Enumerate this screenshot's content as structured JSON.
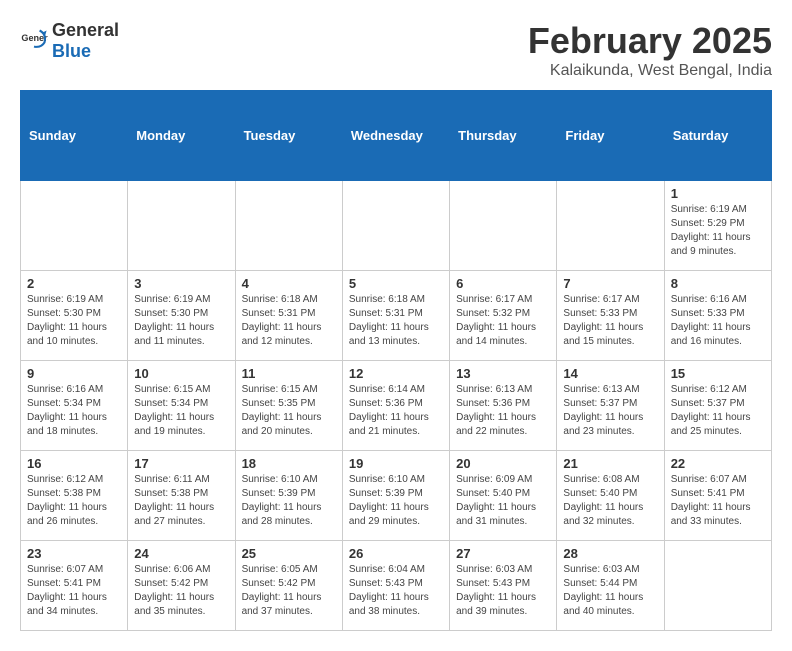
{
  "header": {
    "logo_general": "General",
    "logo_blue": "Blue",
    "title": "February 2025",
    "subtitle": "Kalaikunda, West Bengal, India"
  },
  "weekdays": [
    "Sunday",
    "Monday",
    "Tuesday",
    "Wednesday",
    "Thursday",
    "Friday",
    "Saturday"
  ],
  "weeks": [
    [
      {
        "day": "",
        "info": ""
      },
      {
        "day": "",
        "info": ""
      },
      {
        "day": "",
        "info": ""
      },
      {
        "day": "",
        "info": ""
      },
      {
        "day": "",
        "info": ""
      },
      {
        "day": "",
        "info": ""
      },
      {
        "day": "1",
        "info": "Sunrise: 6:19 AM\nSunset: 5:29 PM\nDaylight: 11 hours and 9 minutes."
      }
    ],
    [
      {
        "day": "2",
        "info": "Sunrise: 6:19 AM\nSunset: 5:30 PM\nDaylight: 11 hours and 10 minutes."
      },
      {
        "day": "3",
        "info": "Sunrise: 6:19 AM\nSunset: 5:30 PM\nDaylight: 11 hours and 11 minutes."
      },
      {
        "day": "4",
        "info": "Sunrise: 6:18 AM\nSunset: 5:31 PM\nDaylight: 11 hours and 12 minutes."
      },
      {
        "day": "5",
        "info": "Sunrise: 6:18 AM\nSunset: 5:31 PM\nDaylight: 11 hours and 13 minutes."
      },
      {
        "day": "6",
        "info": "Sunrise: 6:17 AM\nSunset: 5:32 PM\nDaylight: 11 hours and 14 minutes."
      },
      {
        "day": "7",
        "info": "Sunrise: 6:17 AM\nSunset: 5:33 PM\nDaylight: 11 hours and 15 minutes."
      },
      {
        "day": "8",
        "info": "Sunrise: 6:16 AM\nSunset: 5:33 PM\nDaylight: 11 hours and 16 minutes."
      }
    ],
    [
      {
        "day": "9",
        "info": "Sunrise: 6:16 AM\nSunset: 5:34 PM\nDaylight: 11 hours and 18 minutes."
      },
      {
        "day": "10",
        "info": "Sunrise: 6:15 AM\nSunset: 5:34 PM\nDaylight: 11 hours and 19 minutes."
      },
      {
        "day": "11",
        "info": "Sunrise: 6:15 AM\nSunset: 5:35 PM\nDaylight: 11 hours and 20 minutes."
      },
      {
        "day": "12",
        "info": "Sunrise: 6:14 AM\nSunset: 5:36 PM\nDaylight: 11 hours and 21 minutes."
      },
      {
        "day": "13",
        "info": "Sunrise: 6:13 AM\nSunset: 5:36 PM\nDaylight: 11 hours and 22 minutes."
      },
      {
        "day": "14",
        "info": "Sunrise: 6:13 AM\nSunset: 5:37 PM\nDaylight: 11 hours and 23 minutes."
      },
      {
        "day": "15",
        "info": "Sunrise: 6:12 AM\nSunset: 5:37 PM\nDaylight: 11 hours and 25 minutes."
      }
    ],
    [
      {
        "day": "16",
        "info": "Sunrise: 6:12 AM\nSunset: 5:38 PM\nDaylight: 11 hours and 26 minutes."
      },
      {
        "day": "17",
        "info": "Sunrise: 6:11 AM\nSunset: 5:38 PM\nDaylight: 11 hours and 27 minutes."
      },
      {
        "day": "18",
        "info": "Sunrise: 6:10 AM\nSunset: 5:39 PM\nDaylight: 11 hours and 28 minutes."
      },
      {
        "day": "19",
        "info": "Sunrise: 6:10 AM\nSunset: 5:39 PM\nDaylight: 11 hours and 29 minutes."
      },
      {
        "day": "20",
        "info": "Sunrise: 6:09 AM\nSunset: 5:40 PM\nDaylight: 11 hours and 31 minutes."
      },
      {
        "day": "21",
        "info": "Sunrise: 6:08 AM\nSunset: 5:40 PM\nDaylight: 11 hours and 32 minutes."
      },
      {
        "day": "22",
        "info": "Sunrise: 6:07 AM\nSunset: 5:41 PM\nDaylight: 11 hours and 33 minutes."
      }
    ],
    [
      {
        "day": "23",
        "info": "Sunrise: 6:07 AM\nSunset: 5:41 PM\nDaylight: 11 hours and 34 minutes."
      },
      {
        "day": "24",
        "info": "Sunrise: 6:06 AM\nSunset: 5:42 PM\nDaylight: 11 hours and 35 minutes."
      },
      {
        "day": "25",
        "info": "Sunrise: 6:05 AM\nSunset: 5:42 PM\nDaylight: 11 hours and 37 minutes."
      },
      {
        "day": "26",
        "info": "Sunrise: 6:04 AM\nSunset: 5:43 PM\nDaylight: 11 hours and 38 minutes."
      },
      {
        "day": "27",
        "info": "Sunrise: 6:03 AM\nSunset: 5:43 PM\nDaylight: 11 hours and 39 minutes."
      },
      {
        "day": "28",
        "info": "Sunrise: 6:03 AM\nSunset: 5:44 PM\nDaylight: 11 hours and 40 minutes."
      },
      {
        "day": "",
        "info": ""
      }
    ]
  ]
}
